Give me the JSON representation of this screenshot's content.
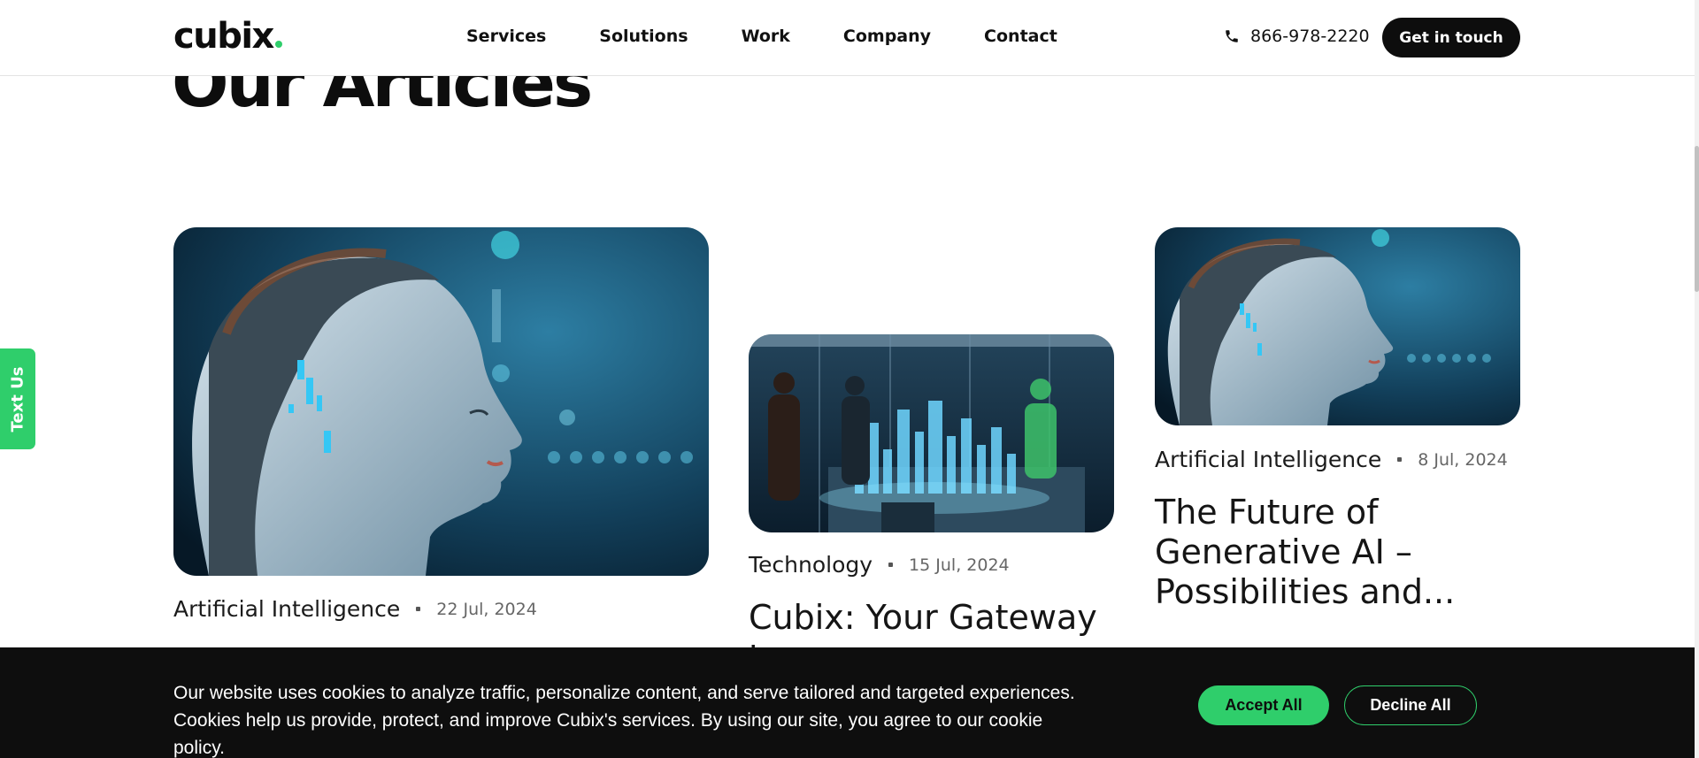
{
  "header": {
    "logo": "cubix",
    "nav": [
      "Services",
      "Solutions",
      "Work",
      "Company",
      "Contact"
    ],
    "phone": "866-978-2220",
    "cta": "Get in touch"
  },
  "page": {
    "heading": "Our Articles",
    "text_us": "Text Us"
  },
  "articles": [
    {
      "category": "Artificial Intelligence",
      "date": "22 Jul, 2024",
      "title": "",
      "image": "ai-robot-woman"
    },
    {
      "category": "Technology",
      "date": "15 Jul, 2024",
      "title": "Cubix: Your Gateway to",
      "image": "hologram-city-meeting"
    },
    {
      "category": "Artificial Intelligence",
      "date": "8 Jul, 2024",
      "title": "The Future of Generative AI – Possibilities and...",
      "image": "ai-robot-woman"
    }
  ],
  "cookie": {
    "line1": "Our website uses cookies to analyze traffic, personalize content, and serve tailored and targeted experiences.",
    "line2": "Cookies help us provide, protect, and improve Cubix's services. By using our site, you agree to our cookie policy.",
    "accept": "Accept All",
    "decline": "Decline All"
  },
  "colors": {
    "accent": "#2fce6b",
    "dark": "#0e0e0e"
  }
}
